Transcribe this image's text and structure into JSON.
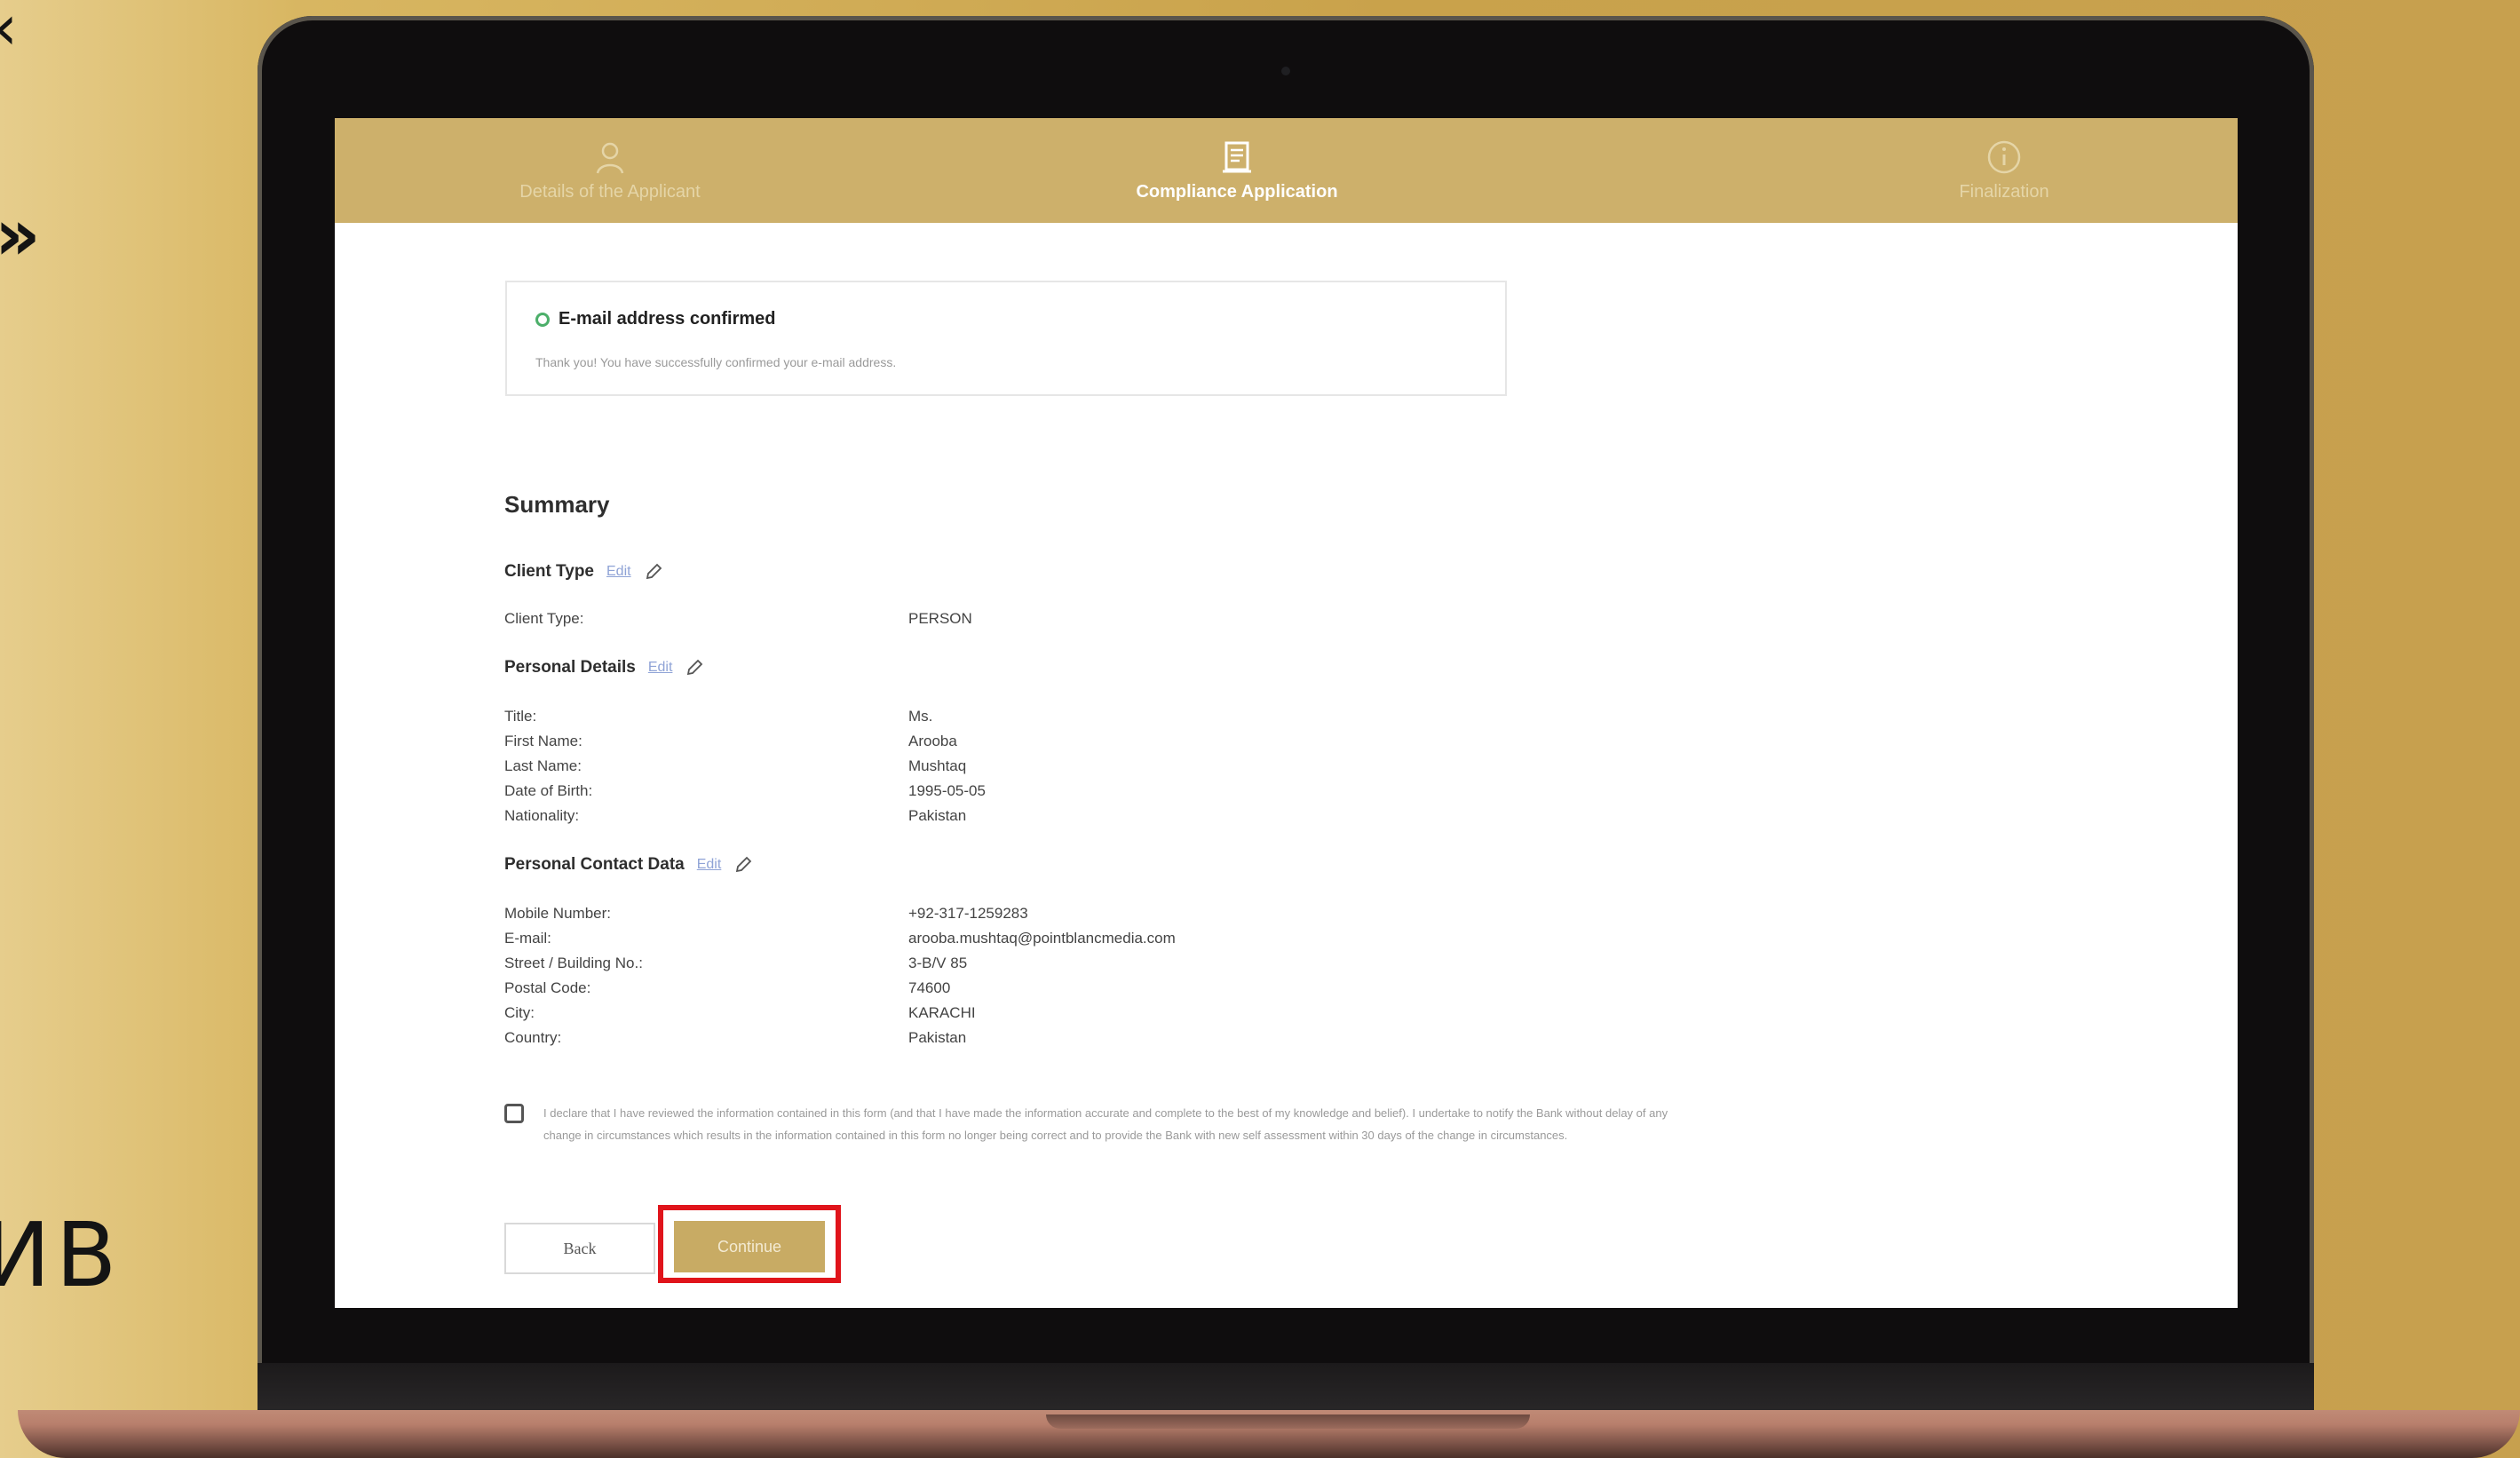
{
  "background": {
    "text_top": "‹",
    "text_mid": "»",
    "text_bottom": "ИВ"
  },
  "stepper": {
    "steps": [
      {
        "label": "Details of the Applicant",
        "icon": "person-icon",
        "active": false
      },
      {
        "label": "Compliance Application",
        "icon": "document-icon",
        "active": true
      },
      {
        "label": "Finalization",
        "icon": "info-icon",
        "active": false
      }
    ]
  },
  "alert": {
    "title": "E-mail address confirmed",
    "message": "Thank you! You have successfully confirmed your e-mail address."
  },
  "summary": {
    "title": "Summary",
    "edit_label": "Edit",
    "client_type": {
      "heading": "Client Type",
      "rows": [
        {
          "label": "Client Type:",
          "value": "PERSON"
        }
      ]
    },
    "personal_details": {
      "heading": "Personal Details",
      "rows": [
        {
          "label": "Title:",
          "value": "Ms."
        },
        {
          "label": "First Name:",
          "value": "Arooba"
        },
        {
          "label": "Last Name:",
          "value": "Mushtaq"
        },
        {
          "label": "Date of Birth:",
          "value": "1995-05-05"
        },
        {
          "label": "Nationality:",
          "value": "Pakistan"
        }
      ]
    },
    "contact_data": {
      "heading": "Personal Contact Data",
      "rows": [
        {
          "label": "Mobile Number:",
          "value": "+92-317-1259283"
        },
        {
          "label": "E-mail:",
          "value": "arooba.mushtaq@pointblancmedia.com"
        },
        {
          "label": "Street / Building No.:",
          "value": "3-B/V 85"
        },
        {
          "label": "Postal Code:",
          "value": "74600"
        },
        {
          "label": "City:",
          "value": "KARACHI"
        },
        {
          "label": "Country:",
          "value": "Pakistan"
        }
      ]
    }
  },
  "declaration": {
    "text": "I declare that I have reviewed the information contained in this form (and that I have made the information accurate and complete to the best of my knowledge and belief). I undertake to notify the Bank without delay of any change in circumstances which results in the information contained in this form no longer being correct and to provide the Bank with new self assessment within 30 days of the change in circumstances."
  },
  "buttons": {
    "back": "Back",
    "continue": "Continue"
  },
  "colors": {
    "accent": "#cdb06b",
    "highlight": "#e0141b",
    "success": "#4caf6a"
  }
}
